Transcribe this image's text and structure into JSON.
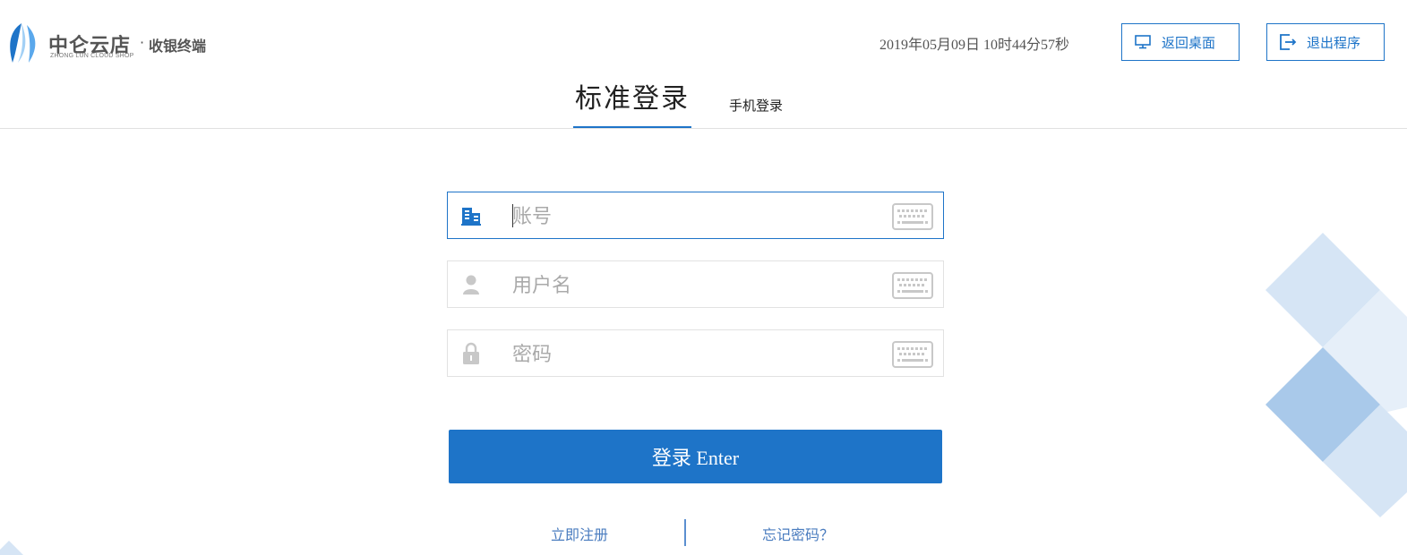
{
  "header": {
    "logo": {
      "main": "中仑云店",
      "separator": "·",
      "sub": "收银终端",
      "english": "ZHONG LUN CLOUD SHOP"
    },
    "datetime": "2019年05月09日 10时44分57秒",
    "buttons": {
      "desktop_label": "返回桌面",
      "exit_label": "退出程序"
    }
  },
  "tabs": {
    "standard": "标准登录",
    "mobile": "手机登录",
    "active": "standard"
  },
  "form": {
    "account": {
      "placeholder": "账号",
      "value": ""
    },
    "username": {
      "placeholder": "用户名",
      "value": ""
    },
    "password": {
      "placeholder": "密码",
      "value": ""
    },
    "login_label": "登录 Enter",
    "register_label": "立即注册",
    "forgot_label": "忘记密码？"
  },
  "colors": {
    "accent": "#1e74c8",
    "border": "#e2e2e2",
    "icon_gray": "#c8c8c8",
    "deco_light": "#d6e5f5",
    "deco_mid": "#a9c9ea"
  },
  "icons": {
    "logo": "leaf-logo-icon",
    "desktop": "monitor-icon",
    "exit": "exit-icon",
    "account": "building-icon",
    "username": "user-icon",
    "password": "lock-icon",
    "keyboard": "keyboard-icon"
  }
}
